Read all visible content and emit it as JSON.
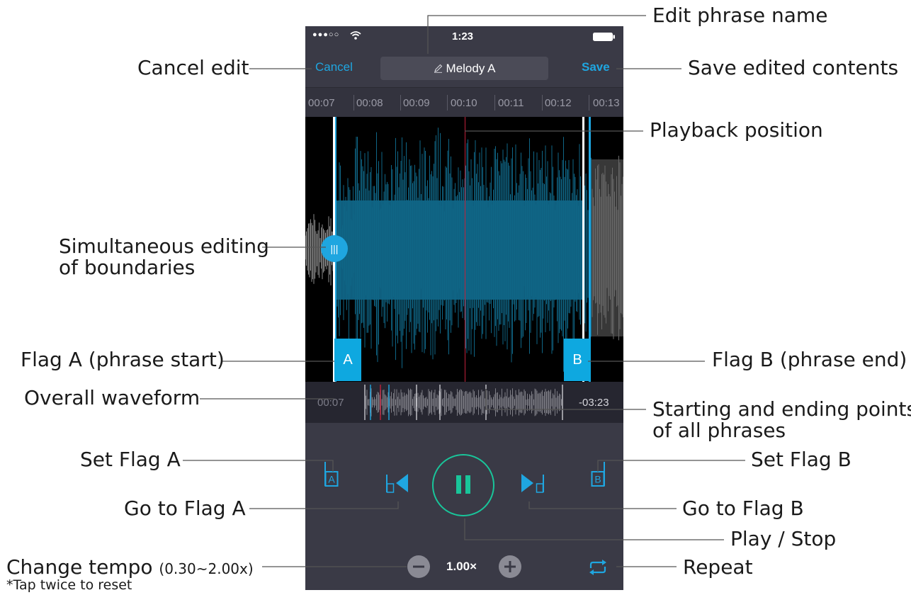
{
  "status": {
    "signal": "●●●○○",
    "time": "1:23"
  },
  "nav": {
    "cancel": "Cancel",
    "title": "Melody A",
    "save": "Save"
  },
  "timeline": {
    "ticks": [
      "00:07",
      "00:08",
      "00:09",
      "00:10",
      "00:11",
      "00:12",
      "00:13"
    ]
  },
  "flags": {
    "a": "A",
    "b": "B",
    "handle": "|||"
  },
  "overview": {
    "start": "00:07",
    "end": "-03:23"
  },
  "controls": {
    "tempo": "1.00×",
    "set_a": "A",
    "set_b": "B"
  },
  "colors": {
    "accent": "#1fa6e0",
    "wave": "#0f5f7f",
    "play_ring": "#19c59a",
    "playhead": "#c0203a"
  },
  "icons": [
    "wifi-icon",
    "battery-icon",
    "pencil-icon",
    "set-flag-a-icon",
    "go-to-flag-a-icon",
    "pause-icon",
    "go-to-flag-b-icon",
    "set-flag-b-icon",
    "minus-icon",
    "plus-icon",
    "repeat-icon"
  ],
  "annotations": {
    "cancel_edit": "Cancel edit",
    "edit_phrase_name": "Edit phrase name",
    "save_edited": "Save edited contents",
    "playback_position": "Playback position",
    "simultaneous_1": "Simultaneous editing",
    "simultaneous_2": "of  boundaries",
    "flag_a": "Flag A (phrase start)",
    "flag_b": "Flag B (phrase end)",
    "overall_waveform": "Overall waveform",
    "starting_1": "Starting and ending points",
    "starting_2": "of all phrases",
    "set_flag_a": "Set Flag A",
    "set_flag_b": "Set Flag B",
    "go_flag_a": "Go to Flag A",
    "go_flag_b": "Go to Flag B",
    "play_stop": "Play / Stop",
    "change_tempo": "Change tempo",
    "tempo_range": "(0.30~2.00x)",
    "tap_twice": "*Tap twice to reset",
    "repeat": "Repeat"
  }
}
